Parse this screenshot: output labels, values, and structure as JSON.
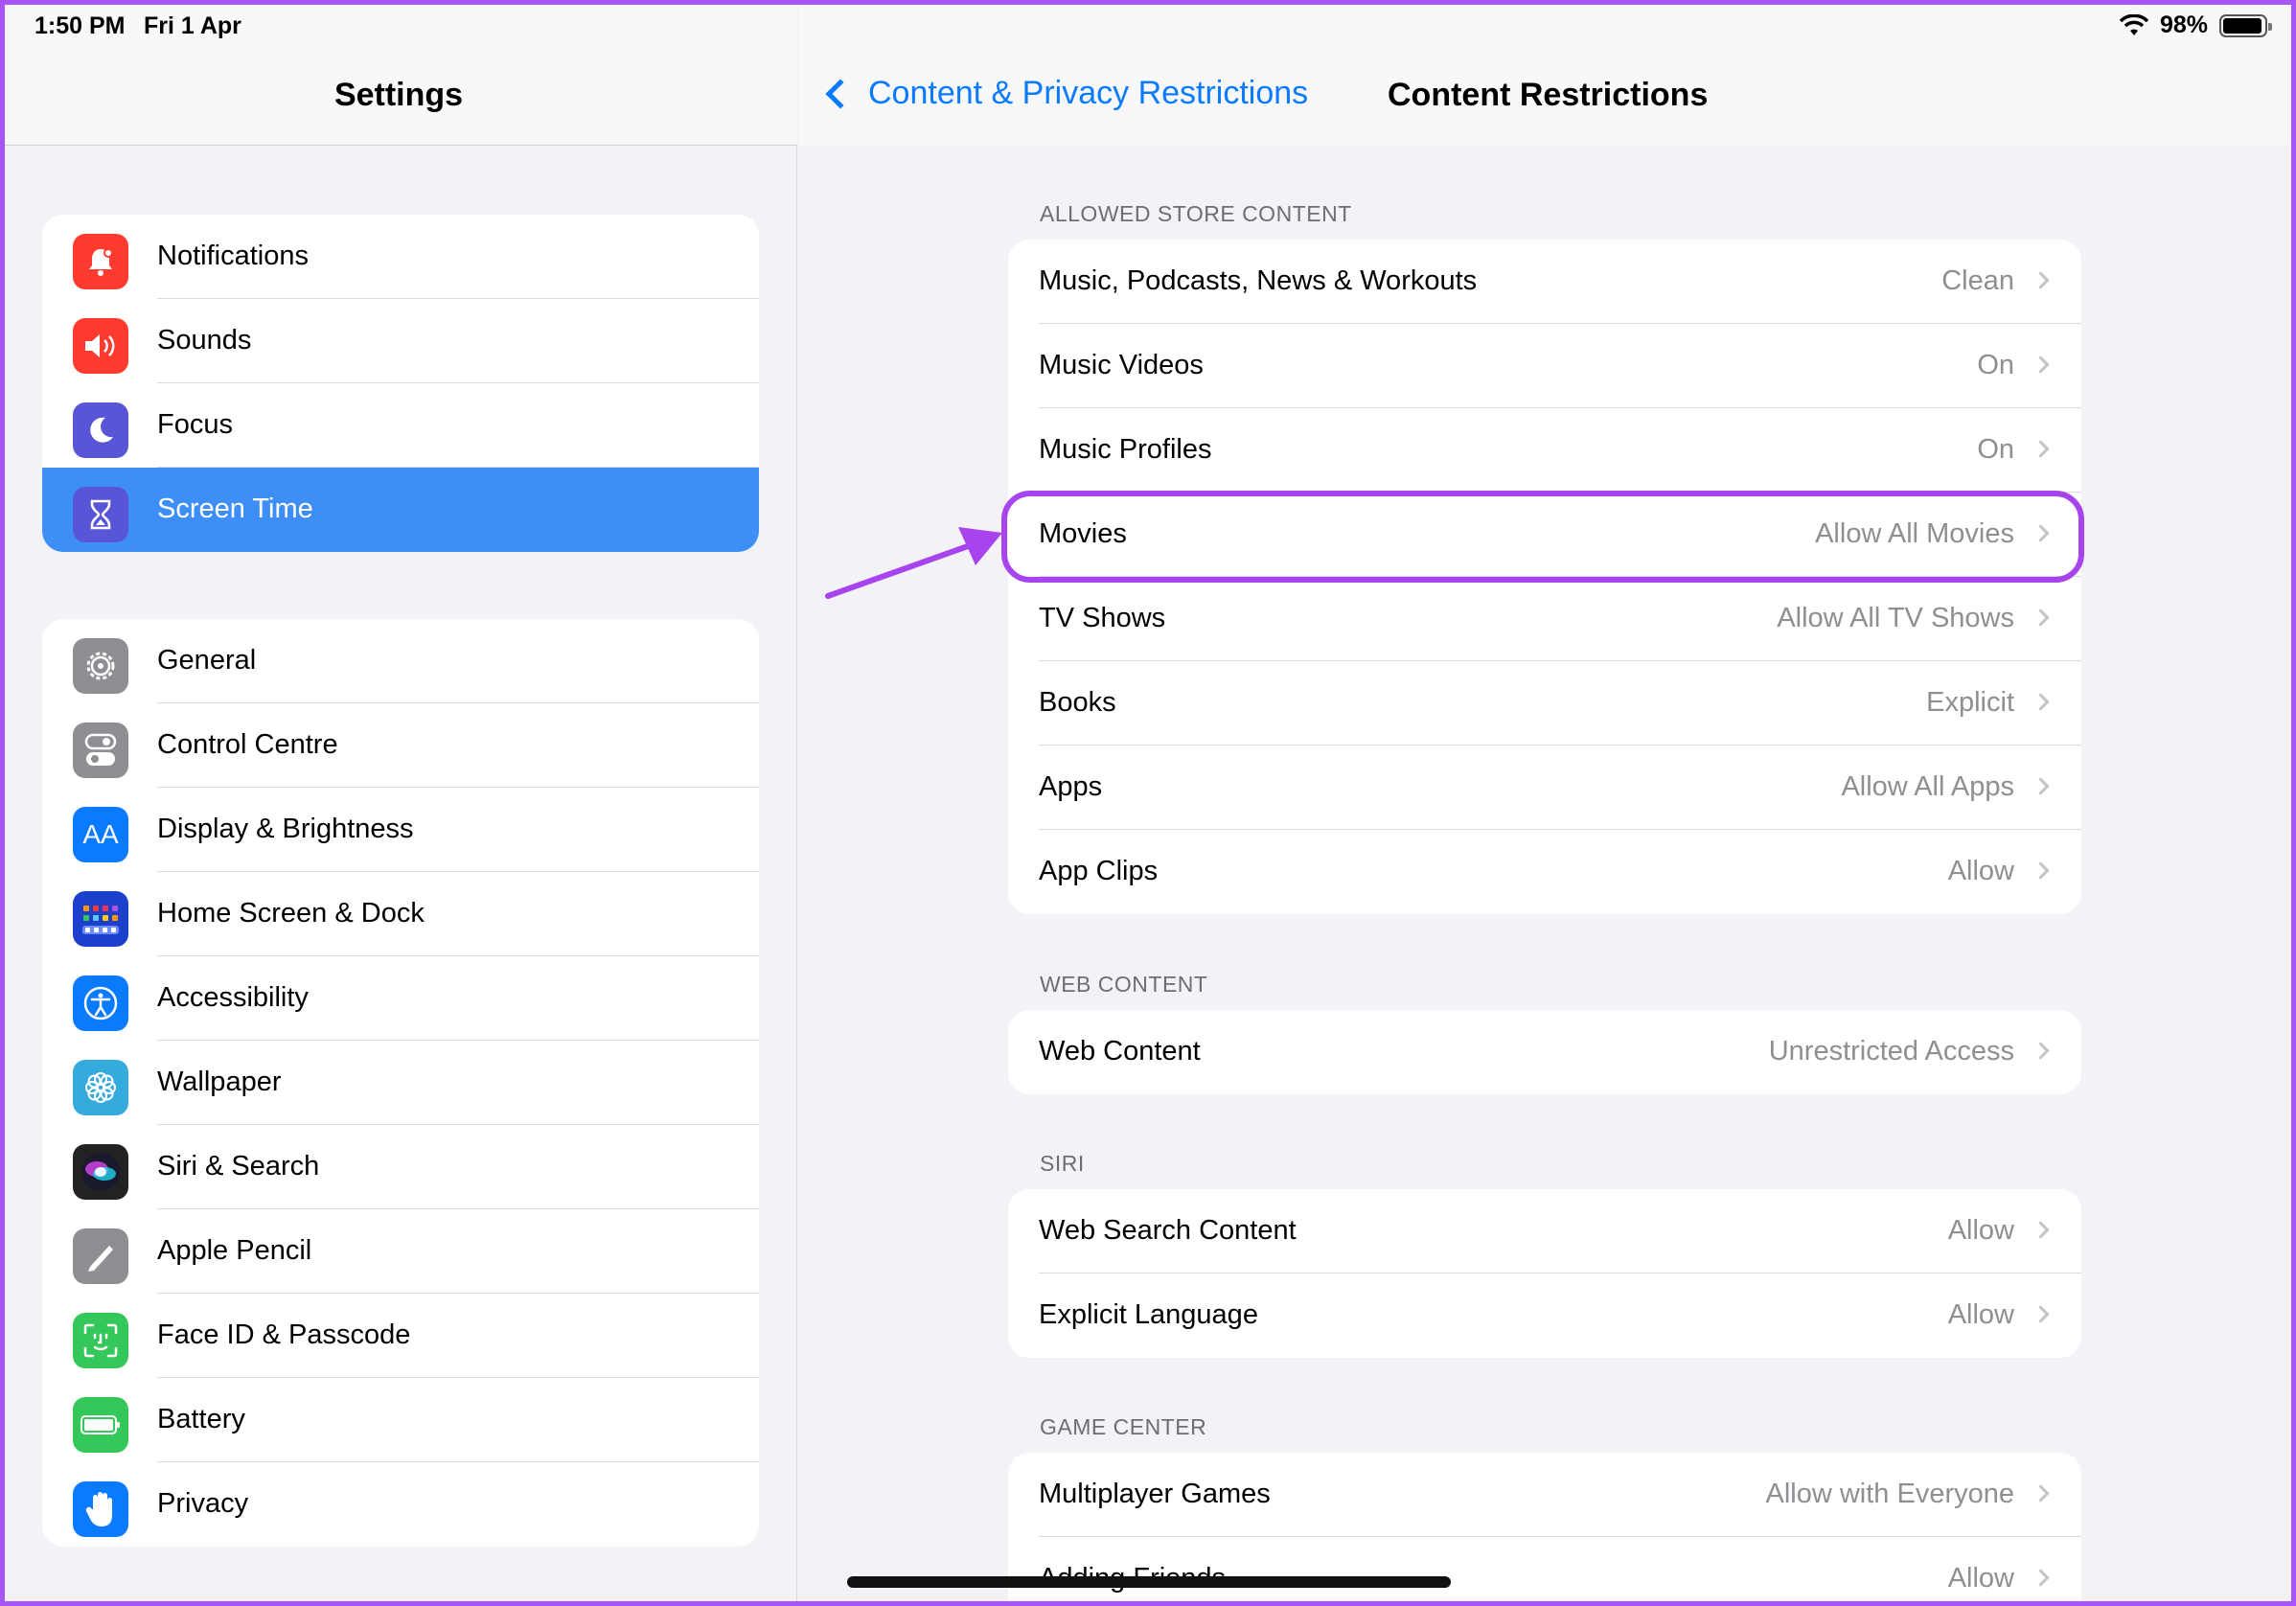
{
  "status": {
    "time": "1:50 PM",
    "date": "Fri 1 Apr",
    "battery_pct": "98%"
  },
  "left": {
    "title": "Settings",
    "group1": [
      {
        "label": "Notifications",
        "icon": "bell-icon",
        "color": "#ff3b30"
      },
      {
        "label": "Sounds",
        "icon": "speaker-icon",
        "color": "#ff3b30"
      },
      {
        "label": "Focus",
        "icon": "moon-icon",
        "color": "#5856d6"
      },
      {
        "label": "Screen Time",
        "icon": "hourglass-icon",
        "color": "#5856d6",
        "selected": true
      }
    ],
    "group2": [
      {
        "label": "General",
        "icon": "gear-icon",
        "color": "#8e8e93"
      },
      {
        "label": "Control Centre",
        "icon": "toggles-icon",
        "color": "#8e8e93"
      },
      {
        "label": "Display & Brightness",
        "icon": "text-size-icon",
        "color": "#0a7aff"
      },
      {
        "label": "Home Screen & Dock",
        "icon": "app-grid-icon",
        "color": "#1c3fcc"
      },
      {
        "label": "Accessibility",
        "icon": "accessibility-icon",
        "color": "#0a7aff"
      },
      {
        "label": "Wallpaper",
        "icon": "flower-icon",
        "color": "#35aadc"
      },
      {
        "label": "Siri & Search",
        "icon": "siri-icon",
        "color": "#222222"
      },
      {
        "label": "Apple Pencil",
        "icon": "pencil-icon",
        "color": "#8e8e93"
      },
      {
        "label": "Face ID & Passcode",
        "icon": "face-id-icon",
        "color": "#34c759"
      },
      {
        "label": "Battery",
        "icon": "battery-icon",
        "color": "#34c759"
      },
      {
        "label": "Privacy",
        "icon": "hand-icon",
        "color": "#0a7aff"
      }
    ]
  },
  "right": {
    "back_label": "Content & Privacy Restrictions",
    "title": "Content Restrictions",
    "sections": [
      {
        "title": "ALLOWED STORE CONTENT",
        "items": [
          {
            "label": "Music, Podcasts, News & Workouts",
            "value": "Clean"
          },
          {
            "label": "Music Videos",
            "value": "On"
          },
          {
            "label": "Music Profiles",
            "value": "On"
          },
          {
            "label": "Movies",
            "value": "Allow All Movies"
          },
          {
            "label": "TV Shows",
            "value": "Allow All TV Shows"
          },
          {
            "label": "Books",
            "value": "Explicit"
          },
          {
            "label": "Apps",
            "value": "Allow All Apps"
          },
          {
            "label": "App Clips",
            "value": "Allow"
          }
        ]
      },
      {
        "title": "WEB CONTENT",
        "items": [
          {
            "label": "Web Content",
            "value": "Unrestricted Access"
          }
        ]
      },
      {
        "title": "SIRI",
        "items": [
          {
            "label": "Web Search Content",
            "value": "Allow"
          },
          {
            "label": "Explicit Language",
            "value": "Allow"
          }
        ]
      },
      {
        "title": "GAME CENTER",
        "items": [
          {
            "label": "Multiplayer Games",
            "value": "Allow with Everyone"
          },
          {
            "label": "Adding Friends",
            "value": "Allow"
          }
        ]
      }
    ]
  },
  "colors": {
    "accent": "#0a7aff",
    "selected_row": "#3e8ef7",
    "annotation": "#a844ee"
  }
}
